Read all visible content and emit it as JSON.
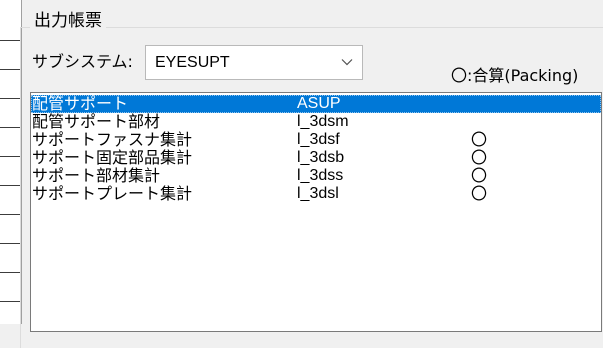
{
  "group": {
    "title": "出力帳票"
  },
  "subsystem": {
    "label": "サブシステム:",
    "value": "EYESUPT"
  },
  "legend": {
    "text": "〇:合算(Packing)"
  },
  "list": {
    "items": [
      {
        "name": "配管サポート",
        "code": "ASUP",
        "mark": "",
        "selected": true
      },
      {
        "name": "配管サポート部材",
        "code": "l_3dsm",
        "mark": "",
        "selected": false
      },
      {
        "name": "サポートファスナ集計",
        "code": "l_3dsf",
        "mark": "〇",
        "selected": false
      },
      {
        "name": "サポート固定部品集計",
        "code": "l_3dsb",
        "mark": "〇",
        "selected": false
      },
      {
        "name": "サポート部材集計",
        "code": "l_3dss",
        "mark": "〇",
        "selected": false
      },
      {
        "name": "サポートプレート集計",
        "code": "l_3dsl",
        "mark": "〇",
        "selected": false
      }
    ]
  },
  "colors": {
    "selection": "#0078d7",
    "window_bg": "#f0f0f0"
  },
  "icons": {
    "combo_arrow": "chevron-down-icon"
  }
}
